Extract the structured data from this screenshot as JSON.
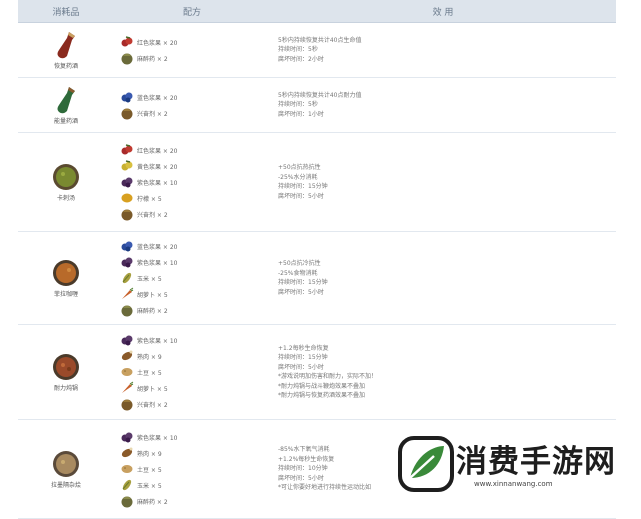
{
  "header": {
    "col_item": "消耗品",
    "col_recipe": "配方",
    "col_effect": "效 用"
  },
  "rows": [
    {
      "name": "恢复药酒",
      "icon": "red-bottle-icon",
      "ingredients": [
        {
          "label": "红色浆果 × 20",
          "icon": "red-berry-icon"
        },
        {
          "label": "麻醉药 × 2",
          "icon": "narcotic-icon"
        }
      ],
      "effects": [
        "5秒内持续恢复共计40点生命值",
        "持续时间：5秒",
        "腐坏时间：2小时"
      ]
    },
    {
      "name": "能量药酒",
      "icon": "green-bottle-icon",
      "ingredients": [
        {
          "label": "蓝色浆果 × 20",
          "icon": "blue-berry-icon"
        },
        {
          "label": "兴奋剂 × 2",
          "icon": "stimulant-icon"
        }
      ],
      "effects": [
        "5秒内持续恢复共计40点耐力值",
        "持续时间：5秒",
        "腐坏时间：1小时"
      ]
    },
    {
      "name": "卡刺汤",
      "icon": "green-soup-icon",
      "ingredients": [
        {
          "label": "红色浆果 × 20",
          "icon": "red-berry-icon"
        },
        {
          "label": "黄色浆果 × 20",
          "icon": "yellow-berry-icon"
        },
        {
          "label": "紫色浆果 × 10",
          "icon": "purple-berry-icon"
        },
        {
          "label": "柠檬 × 5",
          "icon": "lemon-icon"
        },
        {
          "label": "兴奋剂 × 2",
          "icon": "stimulant-icon"
        }
      ],
      "effects": [
        "+50点抗热抗性",
        "-25%水分消耗",
        "持续时间：15分钟",
        "腐坏时间：5小时"
      ]
    },
    {
      "name": "菲拉咖喱",
      "icon": "curry-soup-icon",
      "ingredients": [
        {
          "label": "蓝色浆果 × 20",
          "icon": "blue-berry-icon"
        },
        {
          "label": "紫色浆果 × 10",
          "icon": "purple-berry-icon"
        },
        {
          "label": "玉米 × 5",
          "icon": "corn-icon"
        },
        {
          "label": "胡萝卜 × 5",
          "icon": "carrot-icon"
        },
        {
          "label": "麻醉药 × 2",
          "icon": "narcotic-icon"
        }
      ],
      "effects": [
        "+50点抗冷抗性",
        "-25%食物消耗",
        "持续时间：15分钟",
        "腐坏时间：5小时"
      ]
    },
    {
      "name": "耐力炖锅",
      "icon": "stew-icon",
      "ingredients": [
        {
          "label": "紫色浆果 × 10",
          "icon": "purple-berry-icon"
        },
        {
          "label": "熟肉 × 9",
          "icon": "cooked-meat-icon"
        },
        {
          "label": "土豆 × 5",
          "icon": "potato-icon"
        },
        {
          "label": "胡萝卜 × 5",
          "icon": "carrot-icon"
        },
        {
          "label": "兴奋剂 × 2",
          "icon": "stimulant-icon"
        }
      ],
      "effects": [
        "+1.2每秒生命恢复",
        "持续时间：15分钟",
        "腐坏时间：5小时",
        "*游戏说明加伤害和耐力，实际不加！",
        "*耐力炖锅与战斗鞭炮效果不叠加",
        "*耐力炖锅与恢复药酒效果不叠加"
      ]
    },
    {
      "name": "拉墨隔杂烩",
      "icon": "hotpot-icon",
      "ingredients": [
        {
          "label": "紫色浆果 × 10",
          "icon": "purple-berry-icon"
        },
        {
          "label": "熟肉 × 9",
          "icon": "cooked-meat-icon"
        },
        {
          "label": "土豆 × 5",
          "icon": "potato-icon"
        },
        {
          "label": "玉米 × 5",
          "icon": "corn-icon"
        },
        {
          "label": "麻醉药 × 2",
          "icon": "narcotic-icon"
        }
      ],
      "effects": [
        "-85%水下氧气消耗",
        "+1.2%每秒生命恢复",
        "持续时间：10分钟",
        "腐坏时间：5小时",
        "*可让你要好地进行持续性运动比如"
      ]
    }
  ],
  "watermark": {
    "text": "消费手游网",
    "url": "www.xinnanwang.com",
    "logo_color": "#3a8a3a"
  }
}
